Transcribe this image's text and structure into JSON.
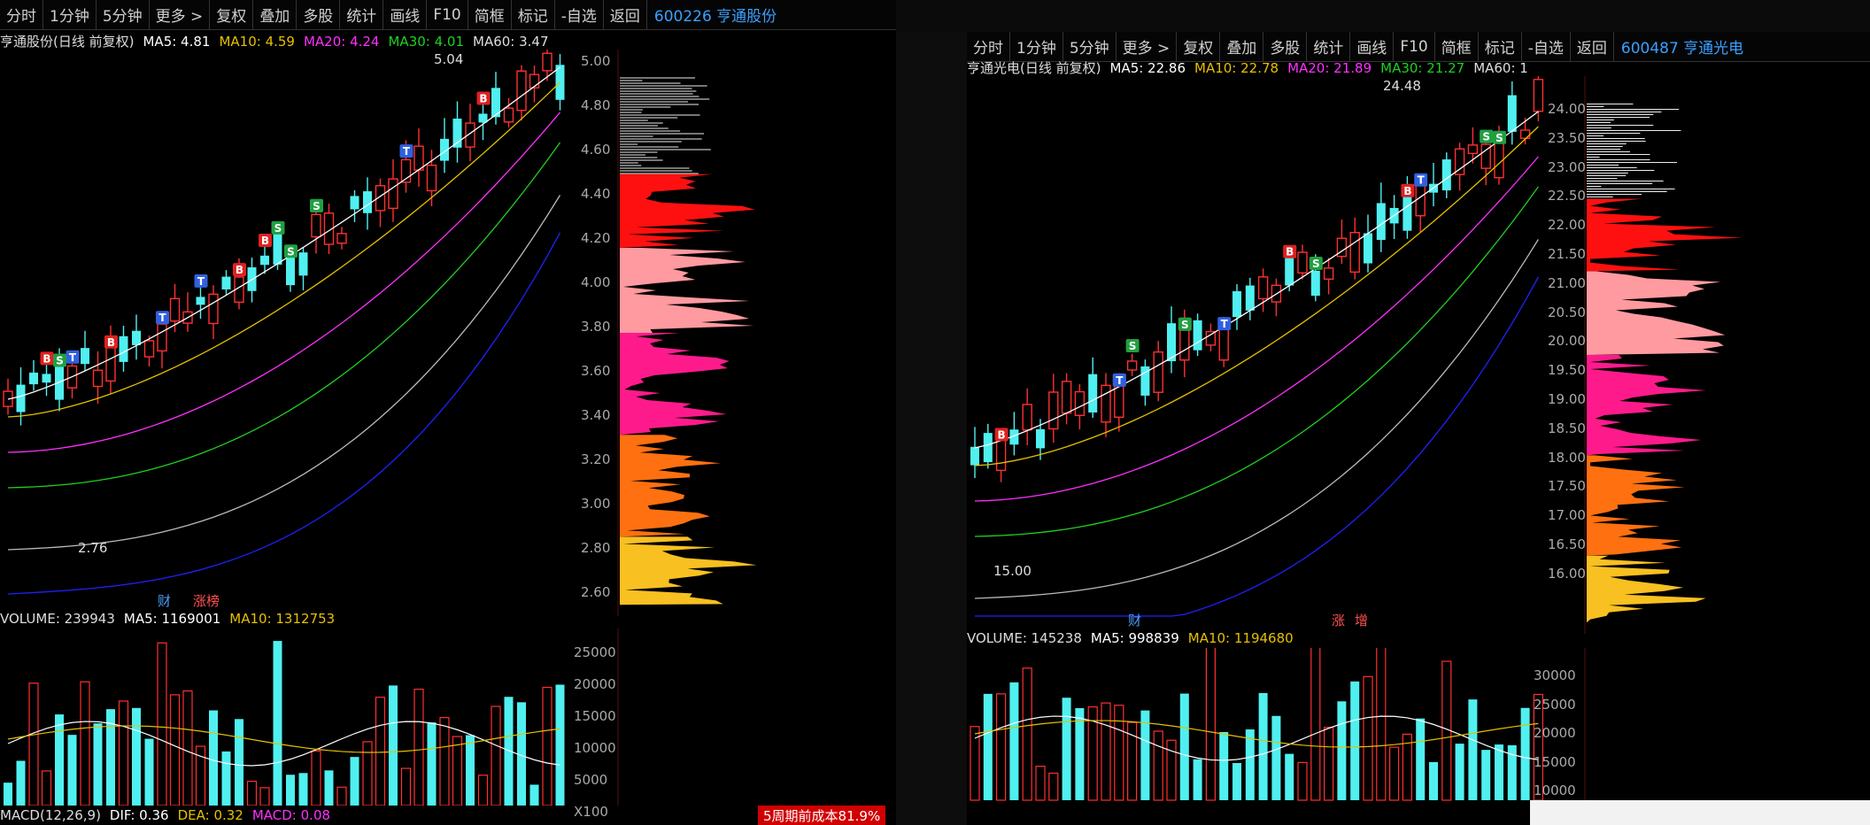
{
  "left": {
    "toolbar": [
      "分时",
      "1分钟",
      "5分钟",
      "更多 >",
      "复权",
      "叠加",
      "多股",
      "统计",
      "画线",
      "F10",
      "简框",
      "标记",
      "-自选",
      "返回"
    ],
    "code": "600226",
    "name": "亨通股份",
    "chart_title": "亨通股份(日线 前复权)",
    "ma": {
      "ma5": "MA5: 4.81",
      "ma10": "MA10: 4.59",
      "ma20": "MA20: 4.24",
      "ma30": "MA30: 4.01",
      "ma60": "MA60: 3.47"
    },
    "high_label": "5.04",
    "low_label": "2.76",
    "price_axis": [
      "5.00",
      "4.80",
      "4.60",
      "4.40",
      "4.20",
      "4.00",
      "3.80",
      "3.60",
      "3.40",
      "3.20",
      "3.00",
      "2.80",
      "2.60"
    ],
    "badges": {
      "cai": "财",
      "zhangbang": "涨榜"
    },
    "volume": {
      "vol": "VOLUME: 239943",
      "ma5": "MA5: 1169001",
      "ma10": "MA10: 1312753"
    },
    "vol_axis": [
      "25000",
      "20000",
      "15000",
      "10000",
      "5000",
      "X100"
    ],
    "macd": {
      "label": "MACD(12,26,9)",
      "dif": "DIF: 0.36",
      "dea": "DEA: 0.32",
      "macd": "MACD: 0.08"
    },
    "status": "5周期前成本81.9%"
  },
  "right": {
    "toolbar": [
      "分时",
      "1分钟",
      "5分钟",
      "更多 >",
      "复权",
      "叠加",
      "多股",
      "统计",
      "画线",
      "F10",
      "简框",
      "标记",
      "-自选",
      "返回"
    ],
    "code": "600487",
    "name": "亨通光电",
    "chart_title": "亨通光电(日线 前复权)",
    "ma": {
      "ma5": "MA5: 22.86",
      "ma10": "MA10: 22.78",
      "ma20": "MA20: 21.89",
      "ma30": "MA30: 21.27",
      "ma60": "MA60: 1"
    },
    "high_label": "24.48",
    "low_label": "15.00",
    "price_axis": [
      "24.00",
      "23.50",
      "23.00",
      "22.50",
      "22.00",
      "21.50",
      "21.00",
      "20.50",
      "20.00",
      "19.50",
      "19.00",
      "18.50",
      "18.00",
      "17.50",
      "17.00",
      "16.50",
      "16.00"
    ],
    "badges": {
      "cai": "财",
      "zhang": "涨",
      "zeng": "增"
    },
    "volume": {
      "vol": "VOLUME: 145238",
      "ma5": "MA5: 998839",
      "ma10": "MA10: 1194680"
    },
    "vol_axis": [
      "30000",
      "25000",
      "20000",
      "15000",
      "10000"
    ]
  },
  "colors": {
    "ma5": "#ffffff",
    "ma10": "#e6c000",
    "ma20": "#ff30ff",
    "ma30": "#20d020",
    "ma60": "#bbbbbb",
    "up": "#ff3030",
    "down": "#50f0f0",
    "code": "#3aa0ff"
  }
}
